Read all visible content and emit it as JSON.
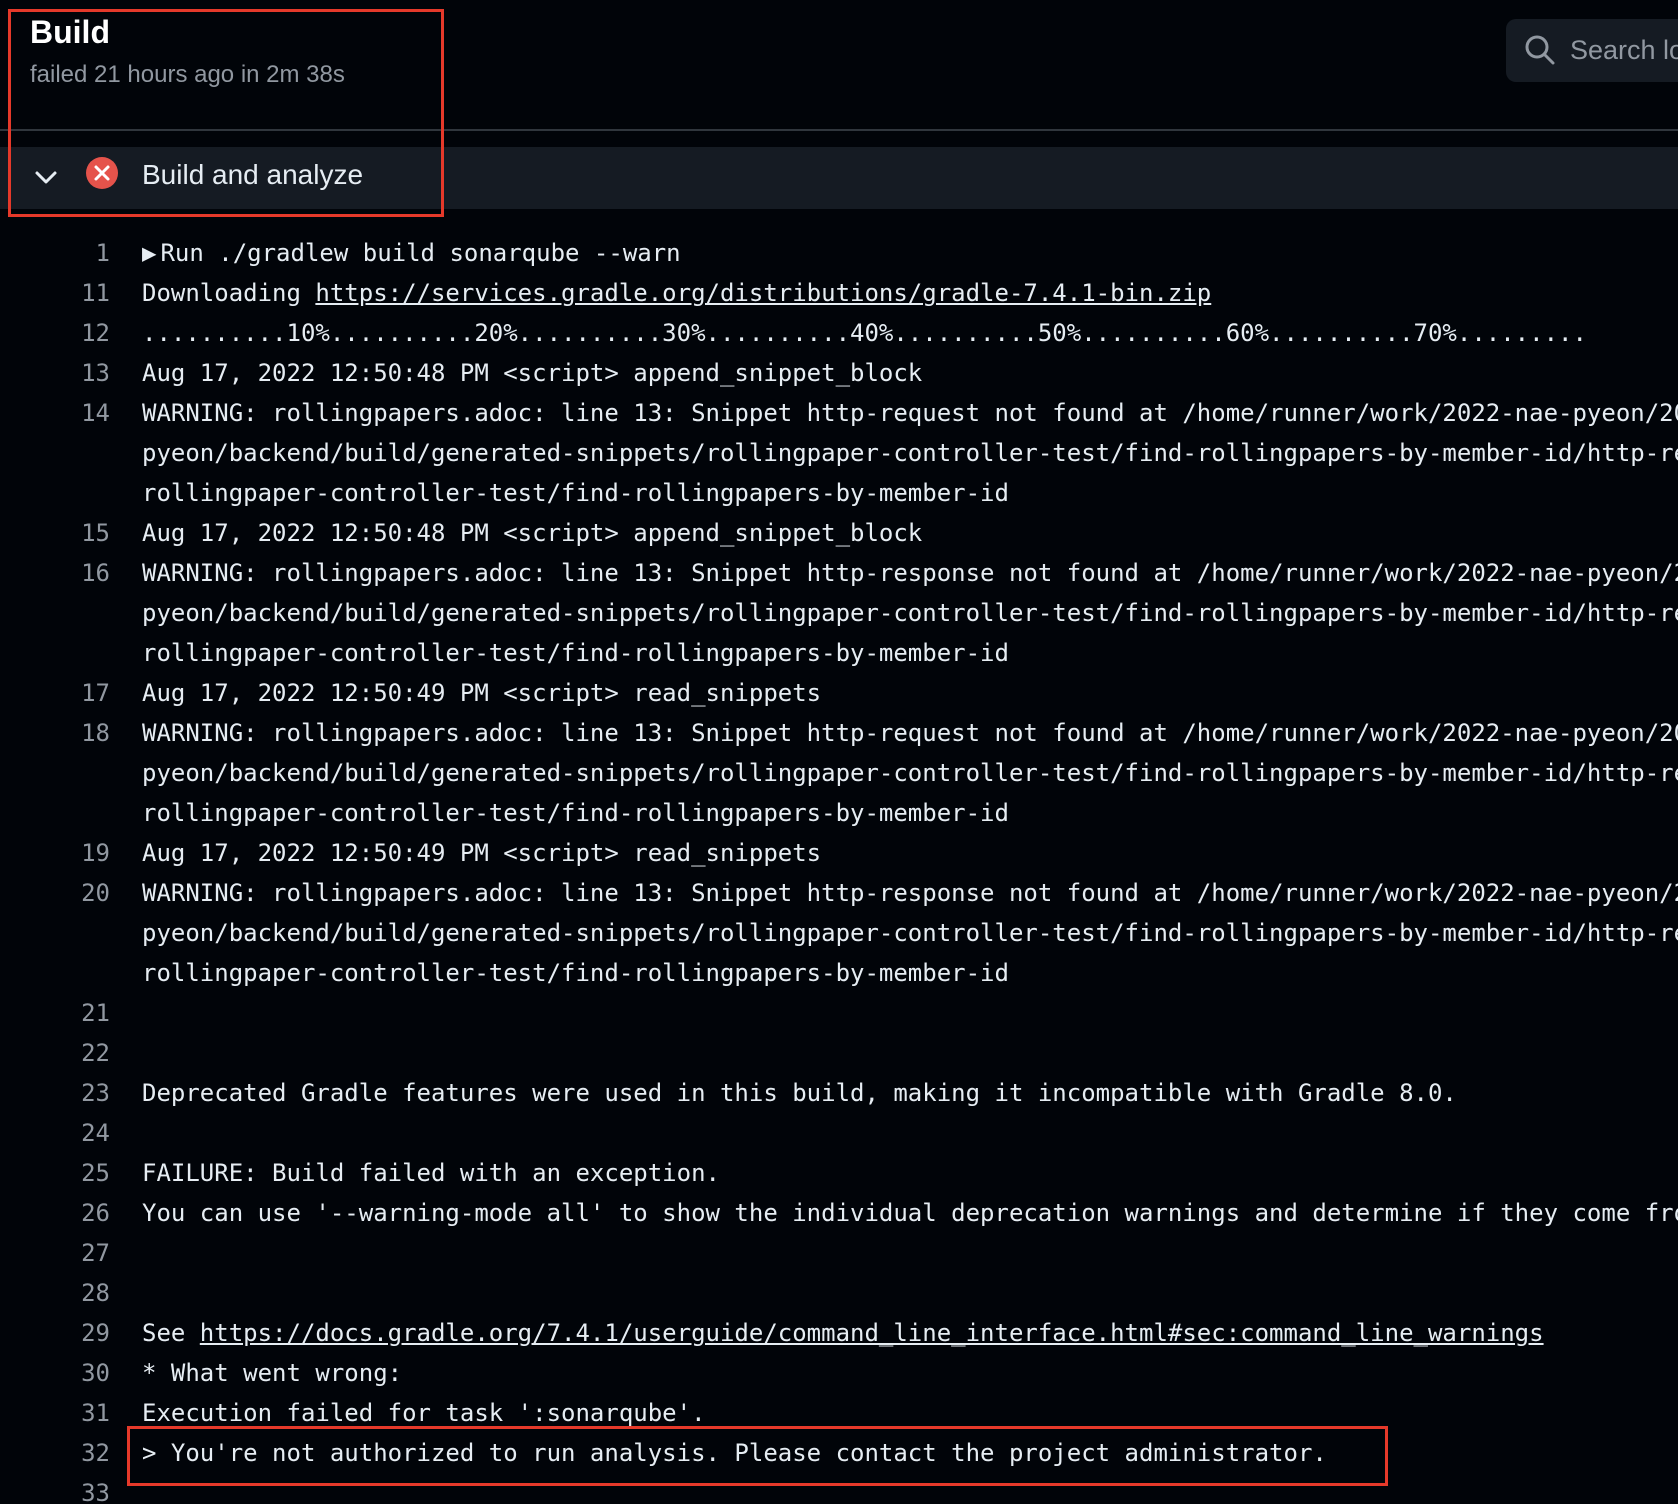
{
  "header": {
    "title": "Build",
    "subtitle": "failed 21 hours ago in 2m 38s",
    "search_placeholder": "Search logs"
  },
  "step": {
    "title": "Build and analyze",
    "status": "failed",
    "status_color": "#e5534b"
  },
  "log": {
    "run_command": "Run ./gradlew build sonarqube --warn",
    "lines": [
      {
        "n": "1",
        "text": ""
      },
      {
        "n": "11",
        "prefix": "Downloading ",
        "link": "https://services.gradle.org/distributions/gradle-7.4.1-bin.zip"
      },
      {
        "n": "12",
        "text": "..........10%..........20%..........30%..........40%..........50%..........60%..........70%........."
      },
      {
        "n": "13",
        "text": "Aug 17, 2022 12:50:48 PM <script> append_snippet_block"
      },
      {
        "n": "14",
        "text": "WARNING: rollingpapers.adoc: line 13: Snippet http-request not found at /home/runner/work/2022-nae-pyeon/20"
      },
      {
        "n": "",
        "text": "pyeon/backend/build/generated-snippets/rollingpaper-controller-test/find-rollingpapers-by-member-id/http-re"
      },
      {
        "n": "",
        "text": "rollingpaper-controller-test/find-rollingpapers-by-member-id"
      },
      {
        "n": "15",
        "text": "Aug 17, 2022 12:50:48 PM <script> append_snippet_block"
      },
      {
        "n": "16",
        "text": "WARNING: rollingpapers.adoc: line 13: Snippet http-response not found at /home/runner/work/2022-nae-pyeon/2"
      },
      {
        "n": "",
        "text": "pyeon/backend/build/generated-snippets/rollingpaper-controller-test/find-rollingpapers-by-member-id/http-re"
      },
      {
        "n": "",
        "text": "rollingpaper-controller-test/find-rollingpapers-by-member-id"
      },
      {
        "n": "17",
        "text": "Aug 17, 2022 12:50:49 PM <script> read_snippets"
      },
      {
        "n": "18",
        "text": "WARNING: rollingpapers.adoc: line 13: Snippet http-request not found at /home/runner/work/2022-nae-pyeon/20"
      },
      {
        "n": "",
        "text": "pyeon/backend/build/generated-snippets/rollingpaper-controller-test/find-rollingpapers-by-member-id/http-re"
      },
      {
        "n": "",
        "text": "rollingpaper-controller-test/find-rollingpapers-by-member-id"
      },
      {
        "n": "19",
        "text": "Aug 17, 2022 12:50:49 PM <script> read_snippets"
      },
      {
        "n": "20",
        "text": "WARNING: rollingpapers.adoc: line 13: Snippet http-response not found at /home/runner/work/2022-nae-pyeon/2"
      },
      {
        "n": "",
        "text": "pyeon/backend/build/generated-snippets/rollingpaper-controller-test/find-rollingpapers-by-member-id/http-re"
      },
      {
        "n": "",
        "text": "rollingpaper-controller-test/find-rollingpapers-by-member-id"
      },
      {
        "n": "21",
        "text": ""
      },
      {
        "n": "22",
        "text": ""
      },
      {
        "n": "23",
        "text": "Deprecated Gradle features were used in this build, making it incompatible with Gradle 8.0."
      },
      {
        "n": "24",
        "text": ""
      },
      {
        "n": "25",
        "text": "FAILURE: Build failed with an exception."
      },
      {
        "n": "26",
        "text": "You can use '--warning-mode all' to show the individual deprecation warnings and determine if they come fro"
      },
      {
        "n": "27",
        "text": ""
      },
      {
        "n": "28",
        "text": ""
      },
      {
        "n": "29",
        "prefix": "See ",
        "link": "https://docs.gradle.org/7.4.1/userguide/command_line_interface.html#sec:command_line_warnings"
      },
      {
        "n": "30",
        "text": "* What went wrong:"
      },
      {
        "n": "31",
        "text": "Execution failed for task ':sonarqube'."
      },
      {
        "n": "32",
        "text": "> You're not authorized to run analysis. Please contact the project administrator."
      },
      {
        "n": "33",
        "text": ""
      }
    ]
  },
  "colors": {
    "background": "#010409",
    "highlight": "#e5392a"
  }
}
